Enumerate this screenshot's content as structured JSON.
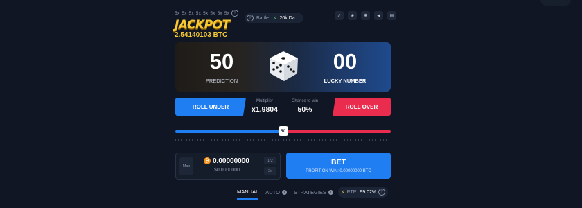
{
  "header": {
    "multipliers": [
      "5x",
      "5x",
      "5x",
      "5x",
      "5x",
      "5x",
      "5x",
      "5x"
    ],
    "jackpot_title": "JACKPOT",
    "jackpot_amount": "2.54140103 BTC",
    "battle_label": "Battle:",
    "battle_value": "20k Da...",
    "top_icons": [
      "rocket-icon",
      "shield-icon",
      "settings-icon",
      "sound-icon",
      "keyboard-icon"
    ]
  },
  "hero": {
    "prediction_value": "50",
    "prediction_label": "PREDICTION",
    "lucky_value": "00",
    "lucky_label": "LUCKY NUMBER"
  },
  "mode": {
    "roll_under_label": "ROLL UNDER",
    "multiplier_label": "Multiplier",
    "multiplier_value": "x1.9804",
    "chance_label": "Chance to win",
    "chance_value": "50%",
    "roll_over_label": "ROLL OVER"
  },
  "slider": {
    "value": 50,
    "label": "50",
    "min": 0,
    "max": 100
  },
  "bet": {
    "max_label": "Max",
    "amount": "0.00000000",
    "usd": "$0.0000000",
    "half_label": "1/2",
    "double_label": "2x",
    "button_label": "BET",
    "profit_label": "PROFIT ON WIN: 0.00000000 BTC"
  },
  "tabs": [
    {
      "label": "MANUAL",
      "active": true
    },
    {
      "label": "AUTO",
      "active": false
    },
    {
      "label": "STRATEGIES",
      "active": false
    }
  ],
  "rtp": {
    "label": "RTP:",
    "value": "99.02%"
  },
  "colors": {
    "accent_blue": "#1f7ef2",
    "accent_red": "#ea2d4f",
    "jackpot_gold": "#f7c933",
    "background": "#101623"
  }
}
